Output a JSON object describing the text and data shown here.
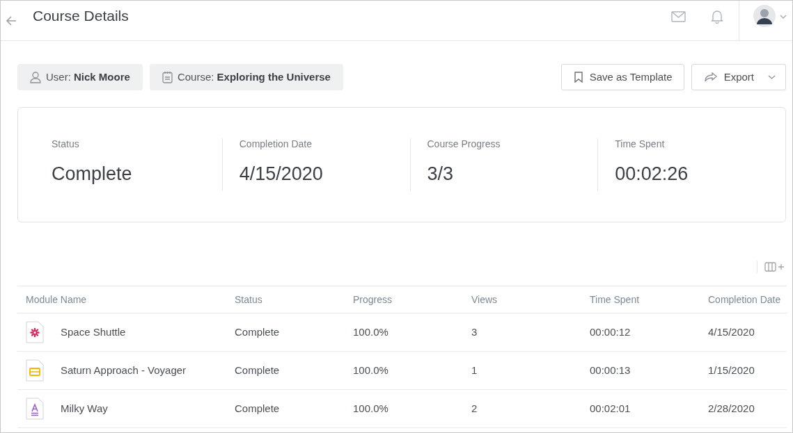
{
  "header": {
    "title": "Course Details"
  },
  "filters": [
    {
      "kind": "user",
      "text": "User: **Nick Moore**"
    },
    {
      "kind": "course",
      "text": "Course: **Exploring the Universe**"
    }
  ],
  "actions": [
    {
      "kind": "bookmark",
      "label": "Save as Template",
      "dropdown": false
    },
    {
      "kind": "share",
      "label": "Export",
      "dropdown": true
    }
  ],
  "stats": [
    {
      "label": "Status",
      "value": "Complete"
    },
    {
      "label": "Completion Date",
      "value": "4/15/2020"
    },
    {
      "label": "Course Progress",
      "value": "3/3"
    },
    {
      "label": "Time Spent",
      "value": "00:02:26"
    }
  ],
  "table": {
    "columns": [
      "Module Name",
      "Status",
      "Progress",
      "Views",
      "Time Spent",
      "Completion Date"
    ],
    "rows": [
      {
        "kind": "interactive",
        "cells": [
          "Space Shuttle",
          "Complete",
          "100.0%",
          "3",
          "00:00:12",
          "4/15/2020"
        ]
      },
      {
        "kind": "slides",
        "cells": [
          "Saturn Approach - Voyager",
          "Complete",
          "100.0%",
          "1",
          "00:00:13",
          "1/15/2020"
        ]
      },
      {
        "kind": "document",
        "cells": [
          "Milky Way",
          "Complete",
          "100.0%",
          "2",
          "00:02:01",
          "2/28/2020"
        ]
      }
    ]
  }
}
